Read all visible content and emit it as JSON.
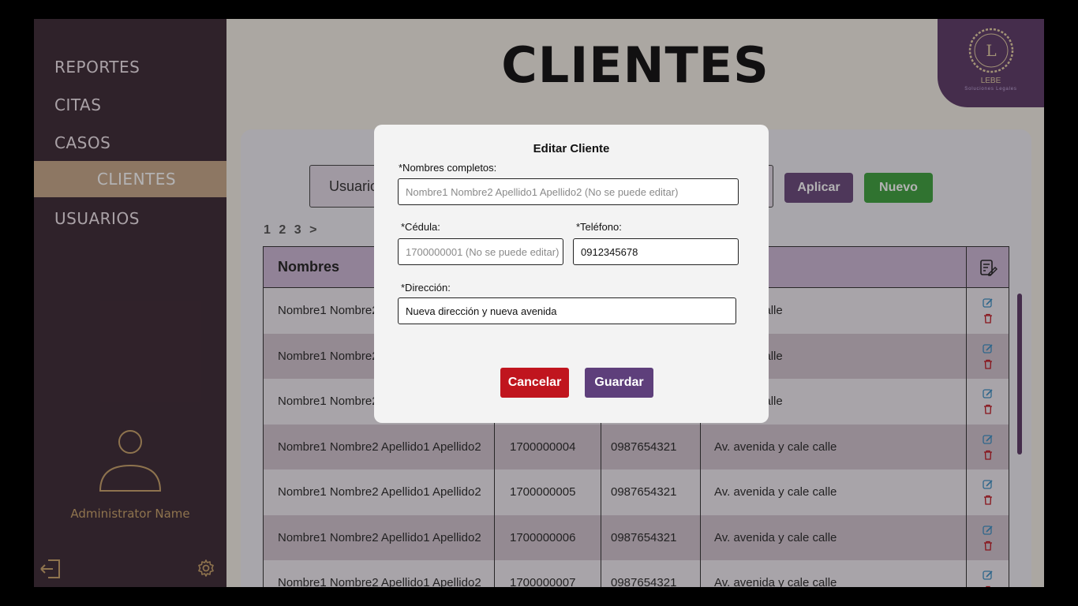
{
  "sidebar": {
    "items": [
      {
        "label": "REPORTES"
      },
      {
        "label": "CITAS"
      },
      {
        "label": "CASOS"
      },
      {
        "label": "CLIENTES"
      },
      {
        "label": "USUARIOS"
      }
    ],
    "admin_name": "Administrator Name"
  },
  "header": {
    "title": "CLIENTES",
    "logo_letter": "L",
    "logo_name": "LEBE",
    "logo_subtitle": "Soluciones Legales"
  },
  "filter": {
    "value": "Usuario",
    "apply_label": "Aplicar",
    "new_label": "Nuevo"
  },
  "pagination": {
    "pages": [
      "1",
      "2",
      "3"
    ],
    "next": ">"
  },
  "table": {
    "headers": [
      "Nombres",
      "",
      "",
      "ón"
    ],
    "rows": [
      {
        "nombres": "Nombre1 Nombre2",
        "cedula": "",
        "telefono": "",
        "direccion": "a y cale calle"
      },
      {
        "nombres": "Nombre1 Nombre2",
        "cedula": "",
        "telefono": "",
        "direccion": "a y cale calle"
      },
      {
        "nombres": "Nombre1 Nombre2",
        "cedula": "",
        "telefono": "",
        "direccion": "a y cale calle"
      },
      {
        "nombres": "Nombre1 Nombre2  Apellido1 Apellido2",
        "cedula": "1700000004",
        "telefono": "0987654321",
        "direccion": "Av. avenida y cale calle"
      },
      {
        "nombres": "Nombre1 Nombre2  Apellido1 Apellido2",
        "cedula": "1700000005",
        "telefono": "0987654321",
        "direccion": "Av. avenida y cale calle"
      },
      {
        "nombres": "Nombre1 Nombre2  Apellido1 Apellido2",
        "cedula": "1700000006",
        "telefono": "0987654321",
        "direccion": "Av. avenida y cale calle"
      },
      {
        "nombres": "Nombre1 Nombre2  Apellido1 Apellido2",
        "cedula": "1700000007",
        "telefono": "0987654321",
        "direccion": "Av. avenida y cale calle"
      }
    ]
  },
  "modal": {
    "title": "Editar Cliente",
    "nombres_label": "*Nombres completos:",
    "nombres_value": "Nombre1 Nombre2 Apellido1 Apellido2 (No se puede editar)",
    "cedula_label": "*Cédula:",
    "cedula_value": "1700000001 (No se puede editar)",
    "telefono_label": "*Teléfono:",
    "telefono_value": "0912345678",
    "direccion_label": "*Dirección:",
    "direccion_value": "Nueva dirección y nueva avenida",
    "cancel_label": "Cancelar",
    "save_label": "Guardar"
  },
  "colors": {
    "sidebar_bg": "#3d2b35",
    "active_item_bg": "#c7a98a",
    "accent_purple": "#5e3f7b",
    "new_green": "#3fa33f",
    "cancel_red": "#c0151e",
    "gold": "#c9a36a"
  }
}
